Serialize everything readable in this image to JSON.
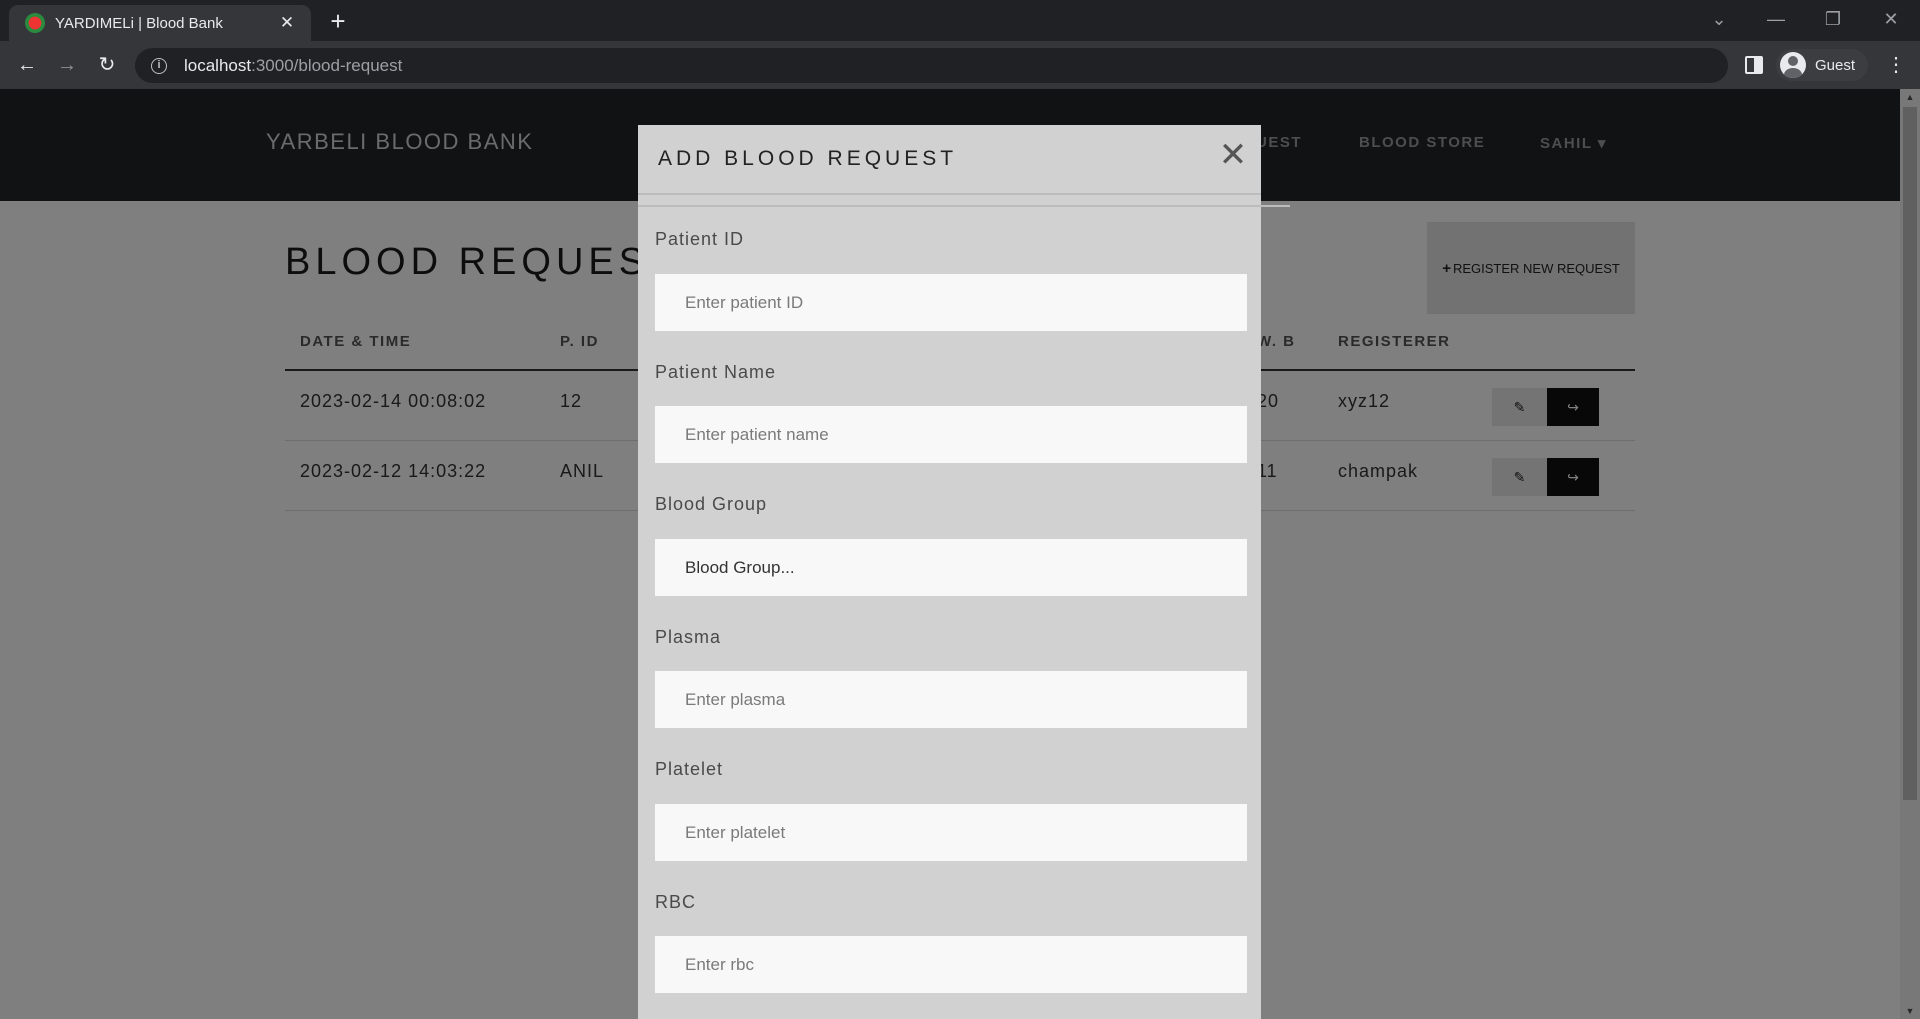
{
  "browser": {
    "tab_title": "YARDIMELi | Blood Bank",
    "tab_close": "✕",
    "new_tab": "+",
    "url_host": "localhost",
    "url_rest": ":3000/blood-request",
    "profile": "Guest",
    "icons": {
      "back": "←",
      "forward": "→",
      "reload": "↻",
      "info": "i",
      "dropdown": "⌄",
      "minimize": "—",
      "restore": "❐",
      "close": "✕",
      "menu": "⋮"
    }
  },
  "site": {
    "brand": "YARBELI BLOOD BANK",
    "nav": [
      "UEST",
      "BLOOD STORE",
      "SAHIL ▾"
    ]
  },
  "page": {
    "heading": "BLOOD REQUEST",
    "register_button": "REGISTER NEW REQUEST",
    "register_plus": "+"
  },
  "table": {
    "headers": [
      "DATE & TIME",
      "P. ID",
      "W. B",
      "REGISTERER"
    ],
    "rows": [
      {
        "datetime": "2023-02-14 00:08:02",
        "pid": "12",
        "wb": "20",
        "registerer": "xyz12"
      },
      {
        "datetime": "2023-02-12 14:03:22",
        "pid": "ANIL",
        "wb": "11",
        "registerer": "champak"
      }
    ],
    "edit_icon": "✎",
    "share_icon": "↪"
  },
  "modal": {
    "title": "ADD BLOOD REQUEST",
    "close": "✕",
    "fields": [
      {
        "label": "Patient ID",
        "placeholder": "Enter patient ID"
      },
      {
        "label": "Patient Name",
        "placeholder": "Enter patient name"
      },
      {
        "label": "Blood Group",
        "value": "Blood Group..."
      },
      {
        "label": "Plasma",
        "placeholder": "Enter plasma"
      },
      {
        "label": "Platelet",
        "placeholder": "Enter platelet"
      },
      {
        "label": "RBC",
        "placeholder": "Enter rbc"
      }
    ]
  },
  "scrollbar": {
    "up": "▲",
    "down": "▼"
  }
}
